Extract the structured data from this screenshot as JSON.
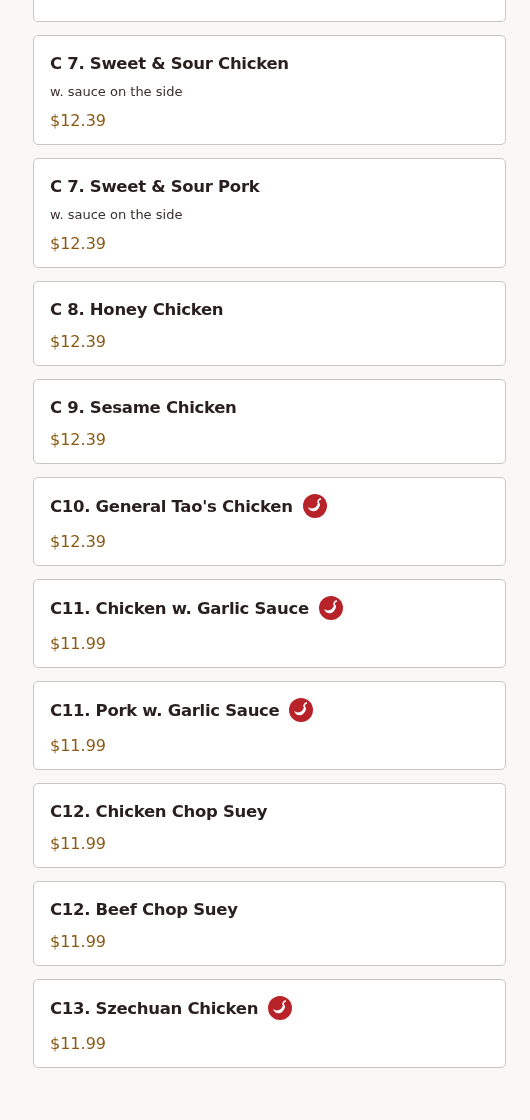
{
  "items": [
    {
      "name": "C 7. Sweet & Sour Chicken",
      "description": "w. sauce on the side",
      "price": "$12.39",
      "spicy": false
    },
    {
      "name": "C 7. Sweet & Sour Pork",
      "description": "w. sauce on the side",
      "price": "$12.39",
      "spicy": false
    },
    {
      "name": "C 8. Honey Chicken",
      "price": "$12.39",
      "spicy": false
    },
    {
      "name": "C 9. Sesame Chicken",
      "price": "$12.39",
      "spicy": false
    },
    {
      "name": "C10. General Tao's Chicken",
      "price": "$12.39",
      "spicy": true
    },
    {
      "name": "C11. Chicken w. Garlic Sauce",
      "price": "$11.99",
      "spicy": true
    },
    {
      "name": "C11. Pork w. Garlic Sauce",
      "price": "$11.99",
      "spicy": true
    },
    {
      "name": "C12. Chicken Chop Suey",
      "price": "$11.99",
      "spicy": false
    },
    {
      "name": "C12. Beef Chop Suey",
      "price": "$11.99",
      "spicy": false
    },
    {
      "name": "C13. Szechuan Chicken",
      "price": "$11.99",
      "spicy": true
    }
  ]
}
